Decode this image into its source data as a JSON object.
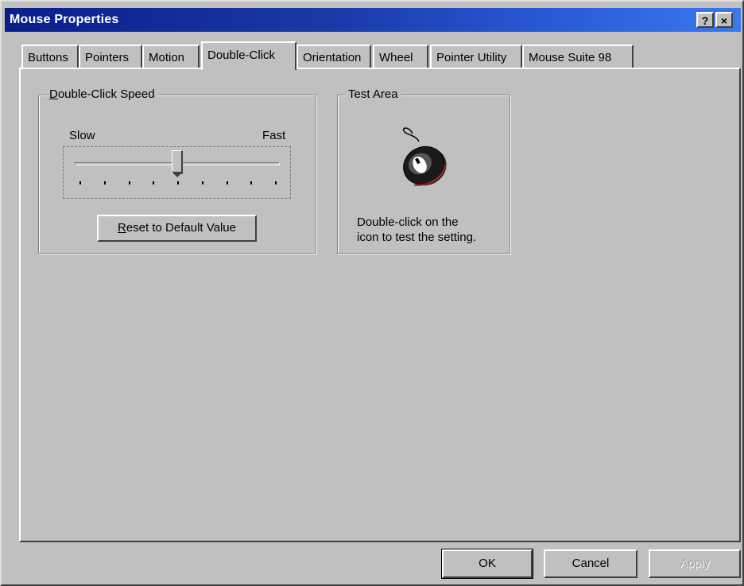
{
  "window": {
    "title": "Mouse Properties",
    "help_button": "?",
    "close_button": "×"
  },
  "tabs": [
    {
      "label": "Buttons",
      "active": false
    },
    {
      "label": "Pointers",
      "active": false
    },
    {
      "label": "Motion",
      "active": false
    },
    {
      "label": "Double-Click",
      "active": true
    },
    {
      "label": "Orientation",
      "active": false
    },
    {
      "label": "Wheel",
      "active": false
    },
    {
      "label": "Pointer Utility",
      "active": false
    },
    {
      "label": "Mouse Suite 98",
      "active": false
    }
  ],
  "double_click_speed": {
    "title_underlined": "D",
    "title_rest": "ouble-Click Speed",
    "slow_label": "Slow",
    "fast_label": "Fast",
    "tick_count": 9,
    "slider_fraction": 0.5,
    "reset_underlined": "R",
    "reset_rest": "eset to Default Value"
  },
  "test_area": {
    "title": "Test Area",
    "icon": "mouse-icon",
    "instructions_line1": "Double-click on the",
    "instructions_line2": "icon to test the setting."
  },
  "buttons": {
    "ok": "OK",
    "cancel": "Cancel",
    "apply": "Apply"
  },
  "colors": {
    "titlebar_start": "#0a1e8a",
    "titlebar_end": "#3a78f0",
    "face": "#c0c0c0"
  }
}
